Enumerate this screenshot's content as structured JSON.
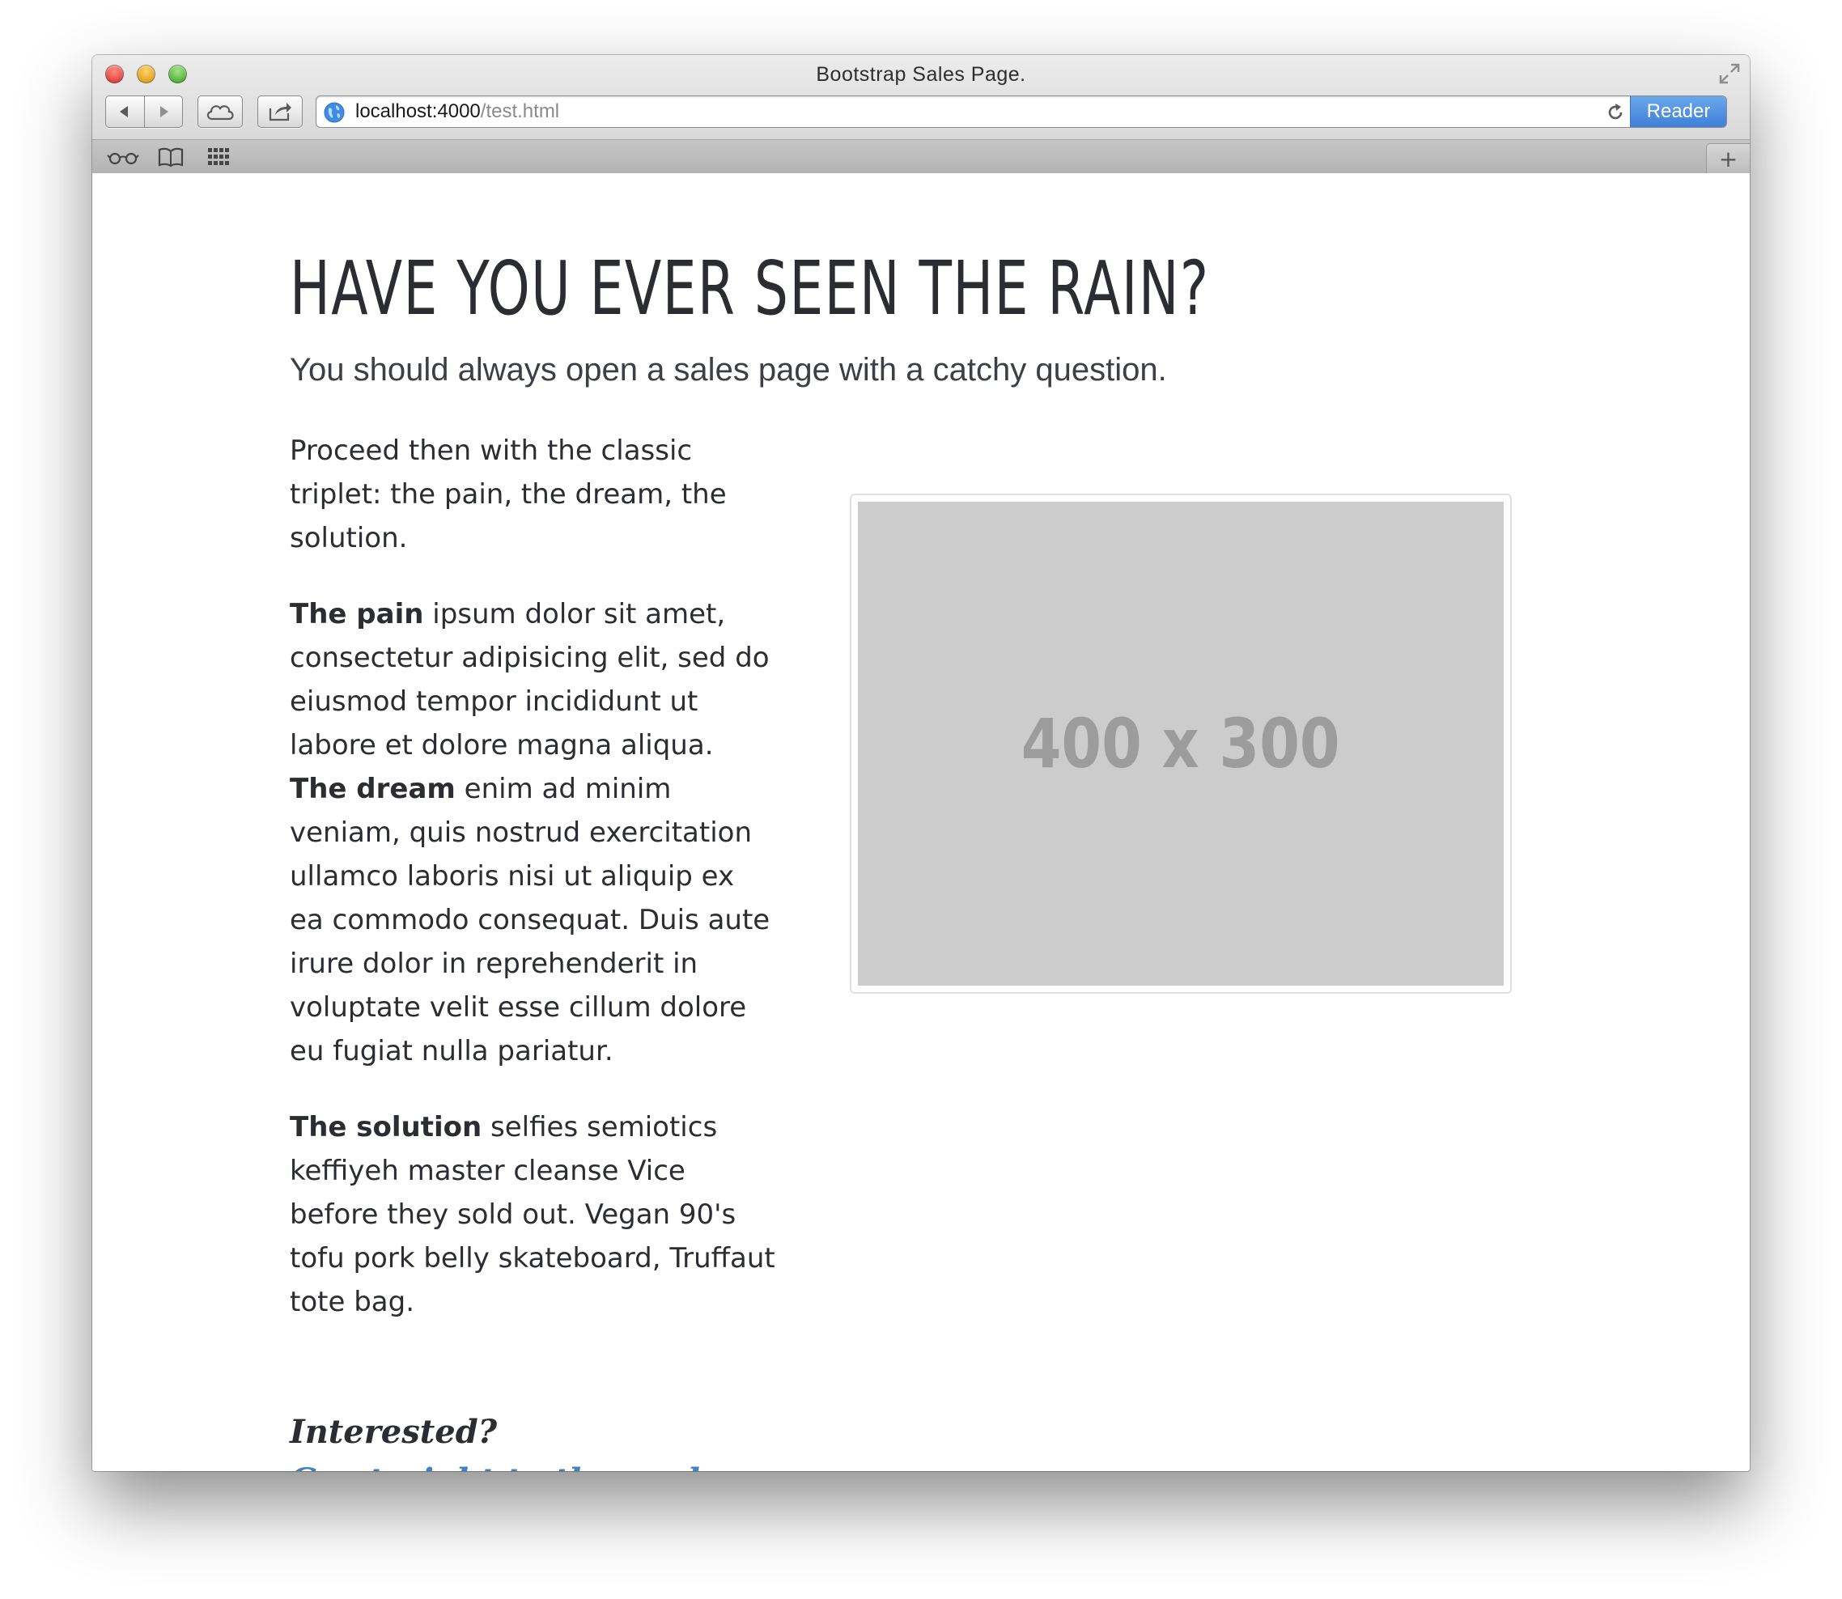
{
  "browser": {
    "window_title": "Bootstrap Sales Page.",
    "url_host": "localhost:4000",
    "url_path": "/test.html",
    "reader_label": "Reader",
    "new_tab_label": "+"
  },
  "page": {
    "headline": "HAVE YOU EVER SEEN THE RAIN?",
    "subheadline": "You should always open a sales page with a catchy question.",
    "intro": "Proceed then with the classic triplet: the pain, the dream, the solution.",
    "pain_label": "The pain",
    "pain_text": " ipsum dolor sit amet, consectetur adipisicing elit, sed do eiusmod tempor incididunt ut labore et dolore magna aliqua. ",
    "dream_label": "The dream",
    "dream_text": " enim ad minim veniam, quis nostrud exercitation ullamco laboris nisi ut aliquip ex ea commodo consequat. Duis aute irure dolor in reprehenderit in voluptate velit esse cillum dolore eu fugiat nulla pariatur.",
    "solution_label": "The solution",
    "solution_text": " selfies semiotics keffiyeh master cleanse Vice before they sold out. Vegan 90's tofu pork belly skateboard, Truffaut tote bag.",
    "cta_question": "Interested?",
    "cta_link": "Go straight to the packages.",
    "placeholder_label": "400 x 300"
  },
  "colors": {
    "text": "#2b2d33",
    "link": "#3d82c4",
    "placeholder_bg": "#cccccc",
    "placeholder_text": "#9c9c9c",
    "reader_button": "#4a8be0"
  },
  "icons": {
    "back": "triangle-left-icon",
    "forward": "triangle-right-icon",
    "icloud": "cloud-icon",
    "share": "share-icon",
    "globe": "globe-icon",
    "reload": "reload-icon",
    "reading_list": "glasses-icon",
    "bookmarks": "book-icon",
    "top_sites": "grid-icon",
    "fullscreen": "expand-arrows-icon"
  }
}
